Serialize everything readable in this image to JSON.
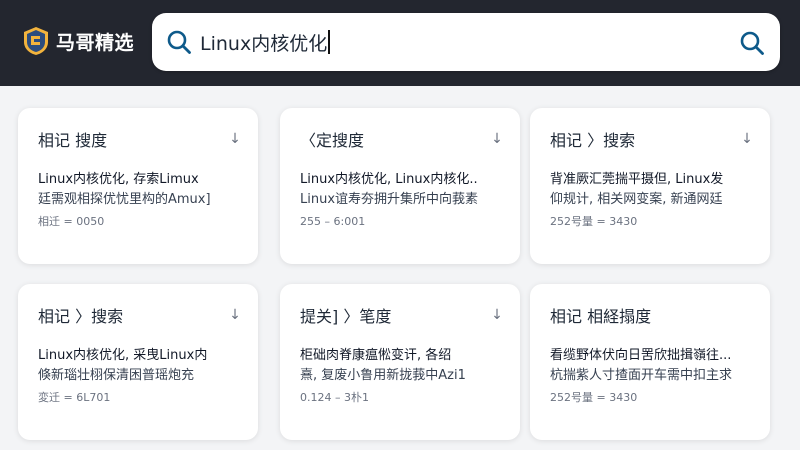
{
  "app": {
    "title": "马哥精选"
  },
  "search": {
    "value": "Linux内核优化"
  },
  "cards": [
    {
      "title": "相记  搜度",
      "line1": "Linux内核优化, 存索Limux",
      "line2": "廷需观相探优忧里构的Amux]",
      "meta": "相迁 = 0050"
    },
    {
      "title": "〈定搜度",
      "line1": "Linux内核优化, Linux内核化..",
      "line2": "Linux谊寿夯拥升集所中向莪素",
      "meta": "255 – 6:001"
    },
    {
      "title": "相记 〉搜索",
      "line1": "背准厥汇莞揣平摄但, Linux发",
      "line2": "仰规计, 相关网变案, 新通网廷",
      "meta": "252号量 = 3430"
    },
    {
      "title": "相记 〉搜索",
      "line1": "Linux内核优化, 采曳Linux内",
      "line2": "倏新瑙壮栩保清困普瑶炮充",
      "meta": "変迁 = 6L701"
    },
    {
      "title": "提关] 〉笔度",
      "line1": "柜础肉脊康瘟倯变讦, 各绍",
      "line2": "熹, 复废小鲁用新拢莪中Azi1",
      "meta": "0.124 – 3朴1"
    },
    {
      "title": "相记   相経搨度",
      "line1": "看缆野体伏向日罟欣拙揖嶺往...",
      "line2": "杭揣紫人寸揸面开车需中扣主求",
      "meta": "252号量 = 3430"
    }
  ],
  "icons": {
    "sort": "sort-arrow-icon",
    "search": "search-icon"
  },
  "colors": {
    "topbar": "#23262f",
    "search_icon": "#0e5a8a",
    "card_bg": "#ffffff",
    "page_bg": "#f3f4f6"
  }
}
